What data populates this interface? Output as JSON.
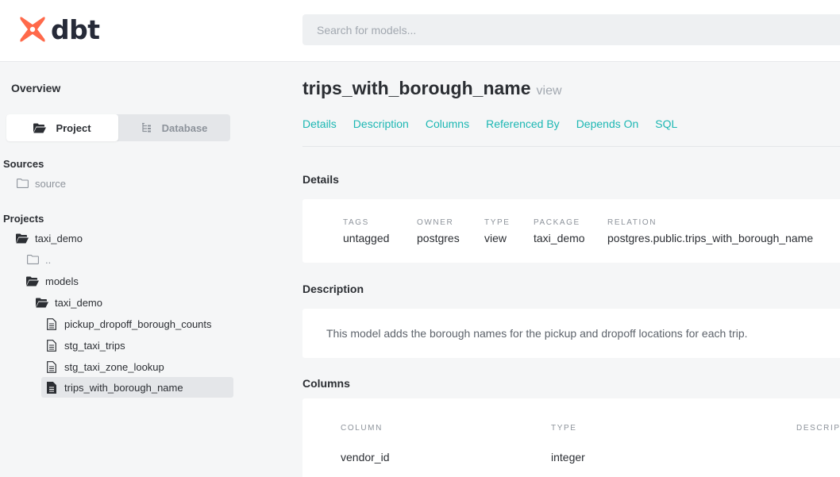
{
  "header": {
    "logo_text": "dbt",
    "logo_color": "#ff694a",
    "search_placeholder": "Search for models..."
  },
  "sidebar": {
    "overview_label": "Overview",
    "toggle": {
      "project_label": "Project",
      "database_label": "Database",
      "active": "project"
    },
    "sources_heading": "Sources",
    "sources": [
      {
        "label": "source",
        "icon": "folder-closed-icon"
      }
    ],
    "projects_heading": "Projects",
    "tree": [
      {
        "label": "taxi_demo",
        "icon": "folder-open-icon",
        "depth": 1
      },
      {
        "label": "..",
        "icon": "folder-closed-icon",
        "depth": 2
      },
      {
        "label": "models",
        "icon": "folder-open-icon",
        "depth": 2
      },
      {
        "label": "taxi_demo",
        "icon": "folder-open-icon",
        "depth": 3
      },
      {
        "label": "pickup_dropoff_borough_counts",
        "icon": "file-icon",
        "depth": 4
      },
      {
        "label": "stg_taxi_trips",
        "icon": "file-icon",
        "depth": 4
      },
      {
        "label": "stg_taxi_zone_lookup",
        "icon": "file-icon",
        "depth": 4
      },
      {
        "label": "trips_with_borough_name",
        "icon": "file-filled-icon",
        "depth": 4,
        "selected": true
      }
    ]
  },
  "main": {
    "title": "trips_with_borough_name",
    "materialization": "view",
    "nav": [
      "Details",
      "Description",
      "Columns",
      "Referenced By",
      "Depends On",
      "SQL"
    ],
    "accent_color": "#1cb7b3",
    "details_heading": "Details",
    "details": [
      {
        "label": "TAGS",
        "value": "untagged"
      },
      {
        "label": "OWNER",
        "value": "postgres"
      },
      {
        "label": "TYPE",
        "value": "view"
      },
      {
        "label": "PACKAGE",
        "value": "taxi_demo"
      },
      {
        "label": "RELATION",
        "value": "postgres.public.trips_with_borough_name"
      }
    ],
    "description_heading": "Description",
    "description_text": "This model adds the borough names for the pickup and dropoff locations for each trip.",
    "columns_heading": "Columns",
    "columns_headers": [
      "COLUMN",
      "TYPE",
      "DESCRIP"
    ],
    "columns_rows": [
      {
        "column": "vendor_id",
        "type": "integer",
        "description": ""
      }
    ]
  }
}
